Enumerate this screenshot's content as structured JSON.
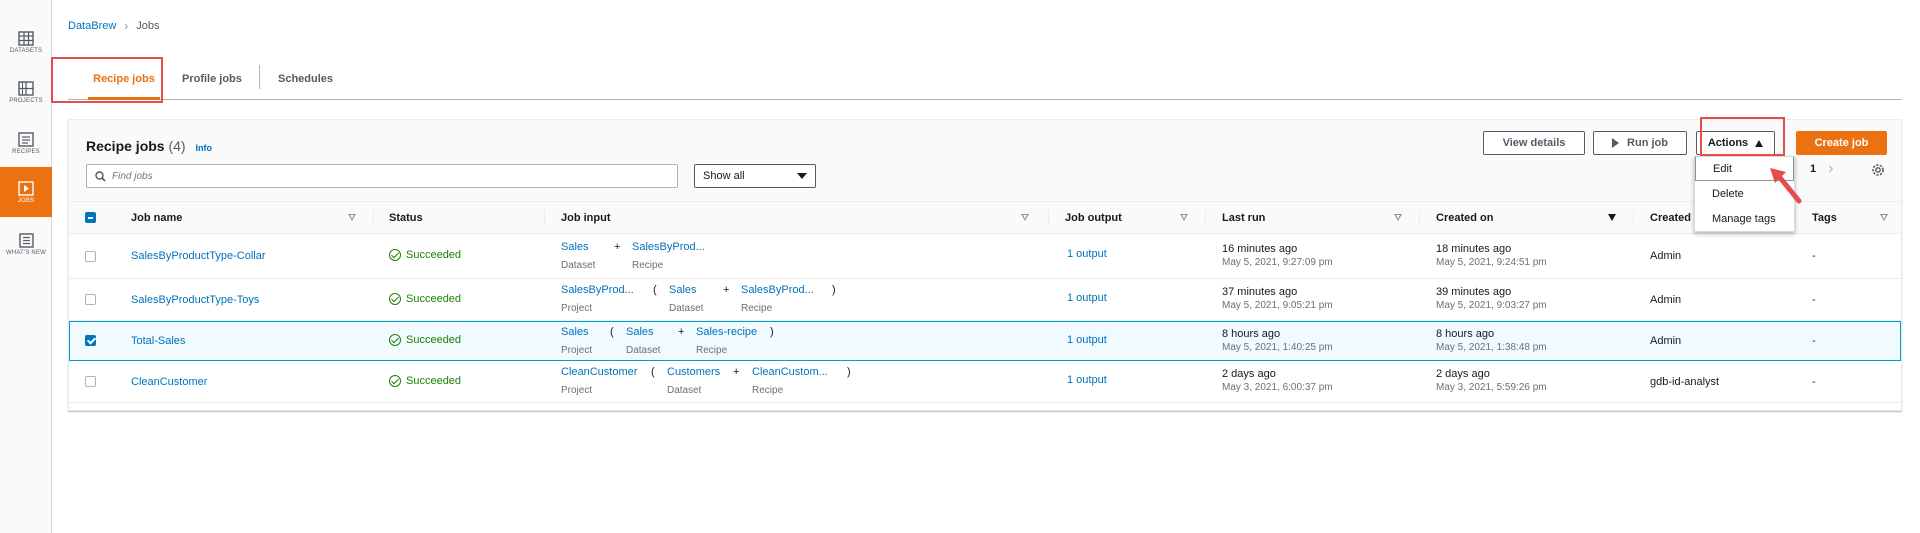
{
  "nav": {
    "items": [
      {
        "label": "DATASETS",
        "icon": "table-icon"
      },
      {
        "label": "PROJECTS",
        "icon": "grid-icon"
      },
      {
        "label": "RECIPES",
        "icon": "list-icon"
      },
      {
        "label": "JOBS",
        "icon": "play-icon"
      },
      {
        "label": "WHAT'S NEW",
        "icon": "newspaper-icon"
      }
    ],
    "active": "JOBS"
  },
  "breadcrumb": {
    "root": "DataBrew",
    "current": "Jobs"
  },
  "tabs": [
    {
      "label": "Recipe jobs",
      "active": true
    },
    {
      "label": "Profile jobs",
      "active": false
    },
    {
      "label": "Schedules",
      "active": false
    }
  ],
  "panel": {
    "title": "Recipe jobs",
    "count": "(4)",
    "info": "Info",
    "search_placeholder": "Find jobs",
    "filter_value": "Show all",
    "buttons": {
      "view_details": "View details",
      "run_job": "Run job",
      "actions": "Actions",
      "create_job": "Create job"
    },
    "page": "1"
  },
  "actions_menu": [
    "Edit",
    "Delete",
    "Manage tags"
  ],
  "columns": [
    "Job name",
    "Status",
    "Job input",
    "Job output",
    "Last run",
    "Created on",
    "Created",
    "Tags"
  ],
  "rows": [
    {
      "name": "SalesByProductType-Collar",
      "status": "Succeeded",
      "input": {
        "a": "Sales",
        "a_sub": "Dataset",
        "op": "+",
        "b": "SalesByProd...",
        "b_sub": "Recipe"
      },
      "output": "1 output",
      "last_run": "16 minutes ago",
      "last_run_ts": "May 5, 2021, 9:27:09 pm",
      "created_on": "18 minutes ago",
      "created_on_ts": "May 5, 2021, 9:24:51 pm",
      "created_by": "Admin",
      "tags": "-",
      "selected": false
    },
    {
      "name": "SalesByProductType-Toys",
      "status": "Succeeded",
      "input": {
        "p": "SalesByProd...",
        "p_sub": "Project",
        "open": "(",
        "a": "Sales",
        "a_sub": "Dataset",
        "op": "+",
        "b": "SalesByProd...",
        "b_sub": "Recipe",
        "close": ")"
      },
      "output": "1 output",
      "last_run": "37 minutes ago",
      "last_run_ts": "May 5, 2021, 9:05:21 pm",
      "created_on": "39 minutes ago",
      "created_on_ts": "May 5, 2021, 9:03:27 pm",
      "created_by": "Admin",
      "tags": "-",
      "selected": false
    },
    {
      "name": "Total-Sales",
      "status": "Succeeded",
      "input": {
        "p": "Sales",
        "p_sub": "Project",
        "open": "(",
        "a": "Sales",
        "a_sub": "Dataset",
        "op": "+",
        "b": "Sales-recipe",
        "b_sub": "Recipe",
        "close": ")"
      },
      "output": "1 output",
      "last_run": "8 hours ago",
      "last_run_ts": "May 5, 2021, 1:40:25 pm",
      "created_on": "8 hours ago",
      "created_on_ts": "May 5, 2021, 1:38:48 pm",
      "created_by": "Admin",
      "tags": "-",
      "selected": true
    },
    {
      "name": "CleanCustomer",
      "status": "Succeeded",
      "input": {
        "p": "CleanCustomer",
        "p_sub": "Project",
        "open": "(",
        "a": "Customers",
        "a_sub": "Dataset",
        "op": "+",
        "b": "CleanCustom...",
        "b_sub": "Recipe",
        "close": ")"
      },
      "output": "1 output",
      "last_run": "2 days ago",
      "last_run_ts": "May 3, 2021, 6:00:37 pm",
      "created_on": "2 days ago",
      "created_on_ts": "May 3, 2021, 5:59:26 pm",
      "created_by": "gdb-id-analyst",
      "tags": "-",
      "selected": false
    }
  ],
  "colors": {
    "accent": "#ec7211",
    "link": "#0073bb",
    "success": "#1d8102",
    "highlight": "#e74c4c"
  }
}
